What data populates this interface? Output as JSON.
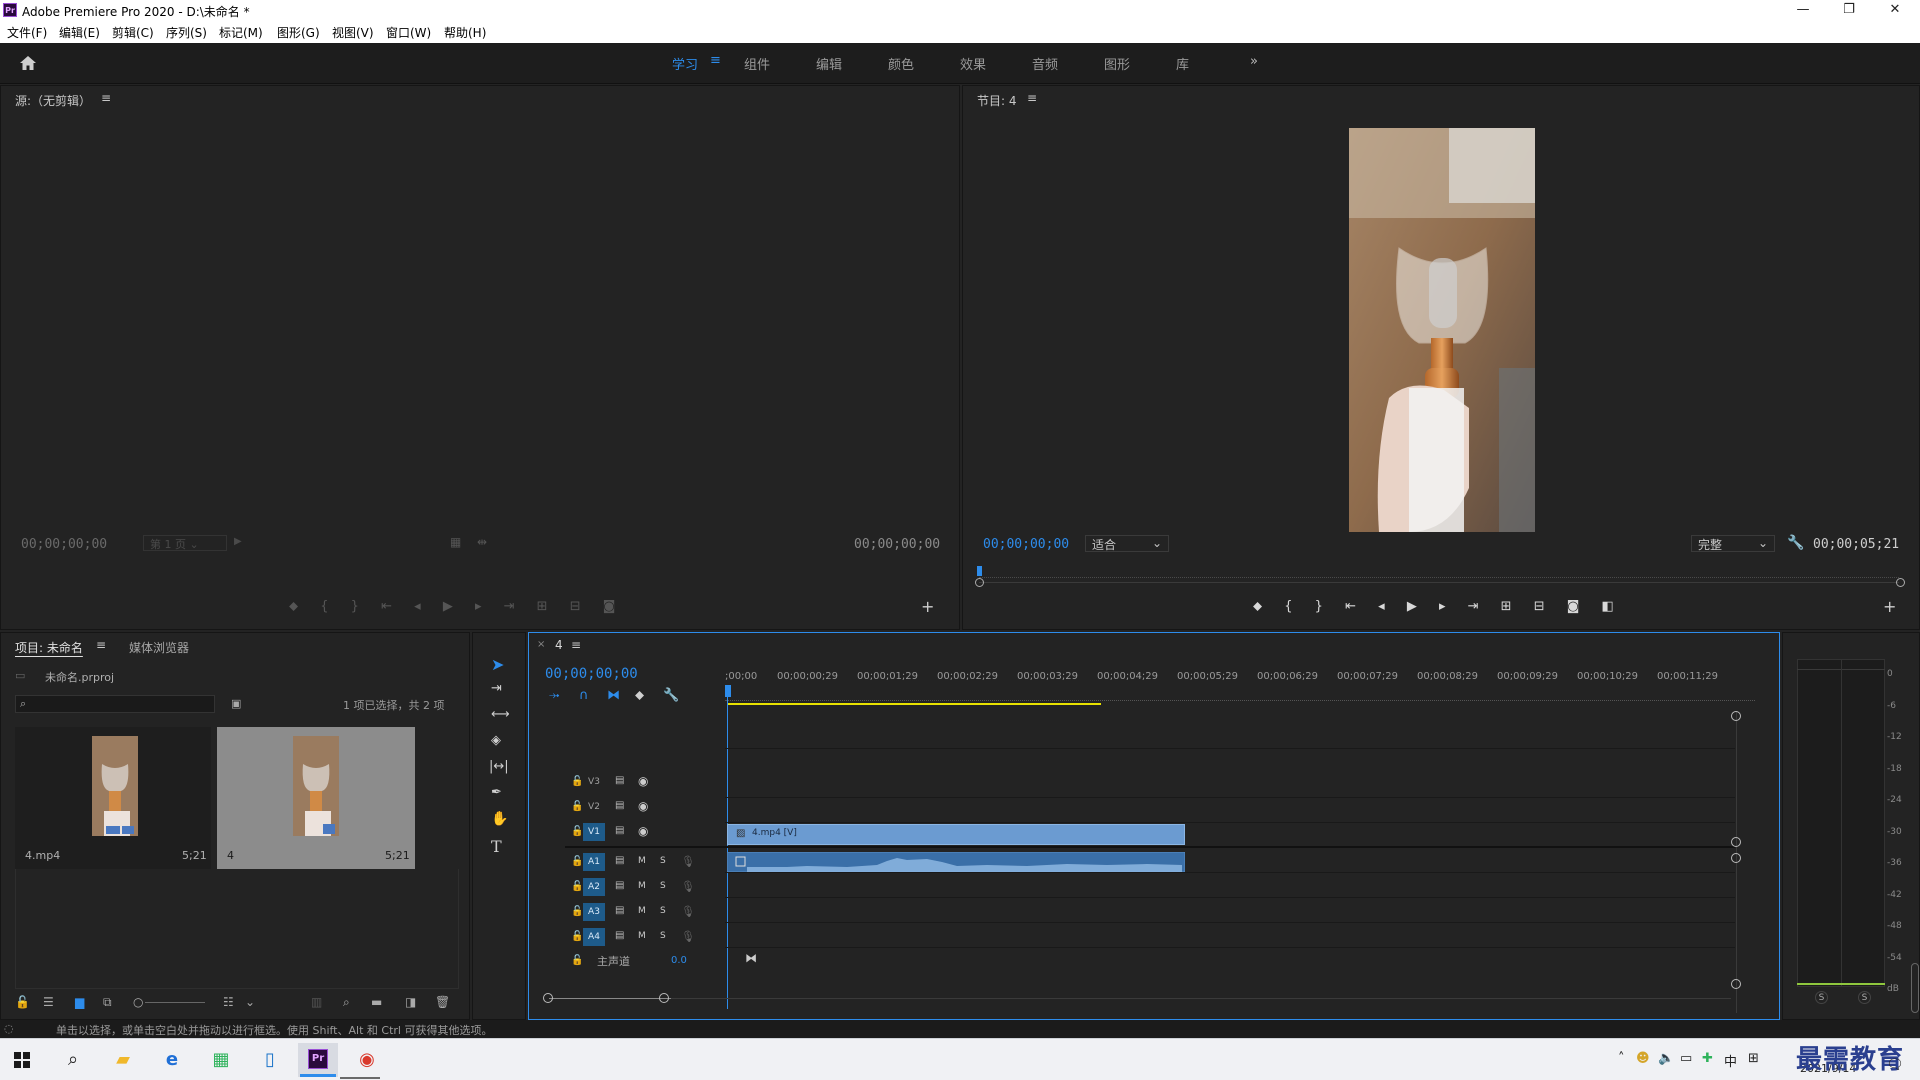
{
  "window": {
    "title": "Adobe Premiere Pro 2020 - D:\\未命名 *",
    "app_icon": "Pr",
    "minimize": "—",
    "restore": "❐",
    "close": "✕"
  },
  "menu": [
    "文件(F)",
    "编辑(E)",
    "剪辑(C)",
    "序列(S)",
    "标记(M)",
    "图形(G)",
    "视图(V)",
    "窗口(W)",
    "帮助(H)"
  ],
  "workspaces": {
    "tabs": [
      "学习",
      "组件",
      "编辑",
      "颜色",
      "效果",
      "音频",
      "图形",
      "库"
    ],
    "active": "学习",
    "more": "»"
  },
  "source_monitor": {
    "title": "源:（无剪辑）",
    "timecode_left": "00;00;00;00",
    "page_select": "第 1 页",
    "timecode_right": "00;00;00;00"
  },
  "program_monitor": {
    "title": "节目: 4",
    "timecode": "00;00;00;00",
    "zoom": "适合",
    "quality": "完整",
    "duration": "00;00;05;21"
  },
  "project_panel": {
    "tab_active": "项目: 未命名",
    "tab_other": "媒体浏览器",
    "file": "未命名.prproj",
    "search_placeholder": "",
    "selection_info": "1 项已选择，共 2 项",
    "items": [
      {
        "name": "4.mp4",
        "duration": "5;21"
      },
      {
        "name": "4",
        "duration": "5;21"
      }
    ]
  },
  "timeline": {
    "sequence": "4",
    "timecode": "00;00;00;00",
    "ruler": [
      ";00;00",
      "00;00;00;29",
      "00;00;01;29",
      "00;00;02;29",
      "00;00;03;29",
      "00;00;04;29",
      "00;00;05;29",
      "00;00;06;29",
      "00;00;07;29",
      "00;00;08;29",
      "00;00;09;29",
      "00;00;10;29",
      "00;00;11;29"
    ],
    "video_tracks": [
      "V3",
      "V2",
      "V1"
    ],
    "audio_tracks": [
      "A1",
      "A2",
      "A3",
      "A4"
    ],
    "master": "主声道",
    "master_value": "0.0",
    "clip_label": "4.mp4 [V]",
    "mute": "M",
    "solo": "S"
  },
  "meters": {
    "ticks": [
      "0",
      "-6",
      "-12",
      "-18",
      "-24",
      "-30",
      "-36",
      "-42",
      "-48",
      "-54",
      "dB"
    ],
    "solo_left": "S",
    "solo_right": "S"
  },
  "status": "单击以选择，或单击空白处并拖动以进行框选。使用 Shift、Alt 和 Ctrl 可获得其他选项。",
  "taskbar": {
    "ime": "中",
    "date": "2021/9/14",
    "watermark": "最需教育"
  },
  "colors": {
    "accent": "#2d8ceb",
    "clip_video": "#6b9bd1",
    "clip_audio": "#3a6fa8",
    "playhead_range": "#e8e200",
    "panel_bg": "#232323"
  }
}
